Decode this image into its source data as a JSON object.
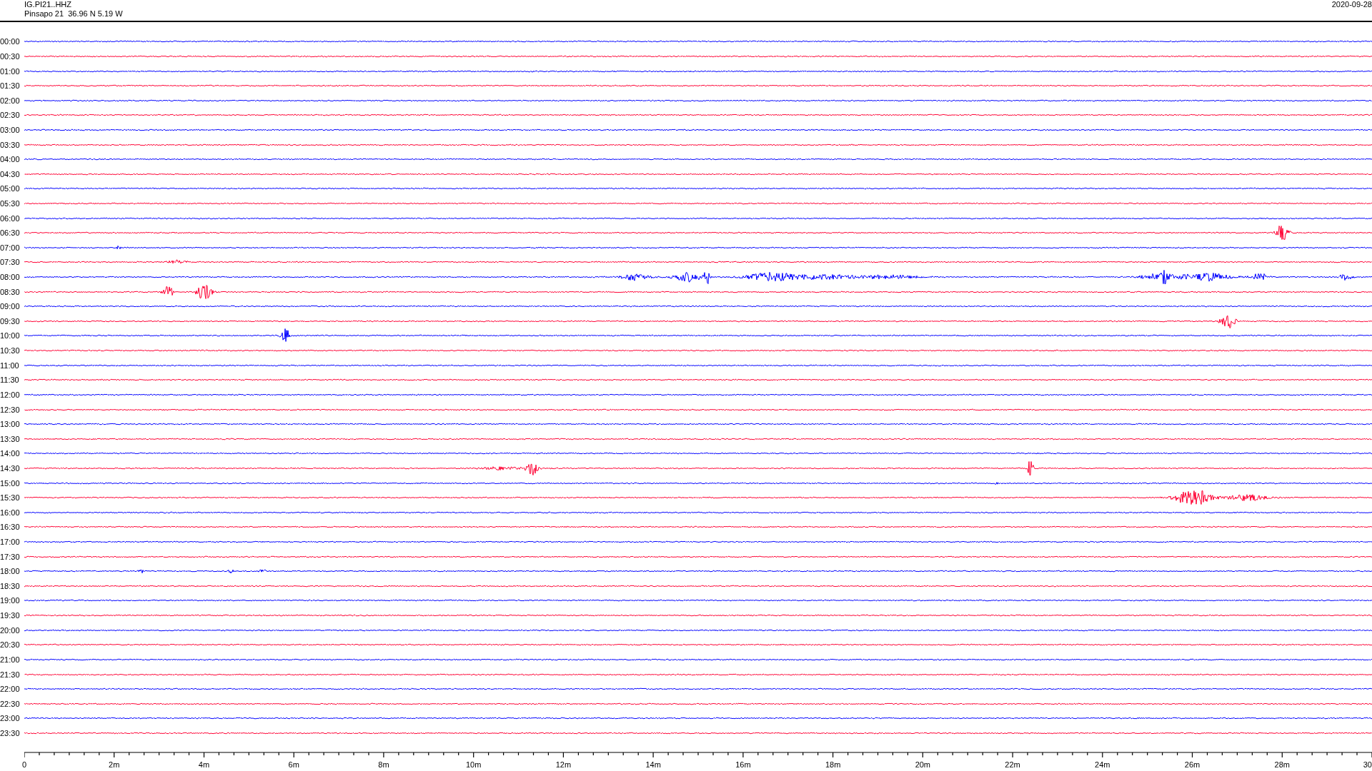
{
  "header": {
    "station": "IG.PI21..HHZ",
    "location": "Pinsapo 21  36.96 N 5.19 W",
    "date": "2020-09-28"
  },
  "traces": [
    {
      "time": "00:00",
      "color": "#0000ff"
    },
    {
      "time": "00:30",
      "color": "#ff0033"
    },
    {
      "time": "01:00",
      "color": "#0000ff"
    },
    {
      "time": "01:30",
      "color": "#ff0033"
    },
    {
      "time": "02:00",
      "color": "#0000ff"
    },
    {
      "time": "02:30",
      "color": "#ff0033"
    },
    {
      "time": "03:00",
      "color": "#0000ff"
    },
    {
      "time": "03:30",
      "color": "#ff0033"
    },
    {
      "time": "04:00",
      "color": "#0000ff"
    },
    {
      "time": "04:30",
      "color": "#ff0033"
    },
    {
      "time": "05:00",
      "color": "#0000ff"
    },
    {
      "time": "05:30",
      "color": "#ff0033"
    },
    {
      "time": "06:00",
      "color": "#0000ff"
    },
    {
      "time": "06:30",
      "color": "#ff0033"
    },
    {
      "time": "07:00",
      "color": "#0000ff"
    },
    {
      "time": "07:30",
      "color": "#ff0033"
    },
    {
      "time": "08:00",
      "color": "#0000ff"
    },
    {
      "time": "08:30",
      "color": "#ff0033"
    },
    {
      "time": "09:00",
      "color": "#0000ff"
    },
    {
      "time": "09:30",
      "color": "#ff0033"
    },
    {
      "time": "10:00",
      "color": "#0000ff"
    },
    {
      "time": "10:30",
      "color": "#ff0033"
    },
    {
      "time": "11:00",
      "color": "#0000ff"
    },
    {
      "time": "11:30",
      "color": "#ff0033"
    },
    {
      "time": "12:00",
      "color": "#0000ff"
    },
    {
      "time": "12:30",
      "color": "#ff0033"
    },
    {
      "time": "13:00",
      "color": "#0000ff"
    },
    {
      "time": "13:30",
      "color": "#ff0033"
    },
    {
      "time": "14:00",
      "color": "#0000ff"
    },
    {
      "time": "14:30",
      "color": "#ff0033"
    },
    {
      "time": "15:00",
      "color": "#0000ff"
    },
    {
      "time": "15:30",
      "color": "#ff0033"
    },
    {
      "time": "16:00",
      "color": "#0000ff"
    },
    {
      "time": "16:30",
      "color": "#ff0033"
    },
    {
      "time": "17:00",
      "color": "#0000ff"
    },
    {
      "time": "17:30",
      "color": "#ff0033"
    },
    {
      "time": "18:00",
      "color": "#0000ff"
    },
    {
      "time": "18:30",
      "color": "#ff0033"
    },
    {
      "time": "19:00",
      "color": "#0000ff"
    },
    {
      "time": "19:30",
      "color": "#ff0033"
    },
    {
      "time": "20:00",
      "color": "#0000ff"
    },
    {
      "time": "20:30",
      "color": "#ff0033"
    },
    {
      "time": "21:00",
      "color": "#0000ff"
    },
    {
      "time": "21:30",
      "color": "#ff0033"
    },
    {
      "time": "22:00",
      "color": "#0000ff"
    },
    {
      "time": "22:30",
      "color": "#ff0033"
    },
    {
      "time": "23:00",
      "color": "#0000ff"
    },
    {
      "time": "23:30",
      "color": "#ff0033"
    }
  ],
  "axis": {
    "labels": [
      "0",
      "2m",
      "4m",
      "6m",
      "8m",
      "10m",
      "12m",
      "14m",
      "16m",
      "18m",
      "20m",
      "22m",
      "24m",
      "26m",
      "28m",
      "30"
    ]
  }
}
